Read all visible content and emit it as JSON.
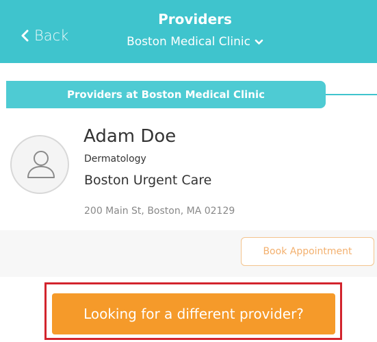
{
  "header": {
    "back_label": "Back",
    "title": "Providers",
    "clinic": "Boston Medical Clinic",
    "bg_color": "#3fc4cd"
  },
  "section": {
    "title": "Providers at Boston Medical Clinic"
  },
  "provider": {
    "name": "Adam Doe",
    "specialty": "Dermatology",
    "organization": "Boston Urgent Care",
    "address": "200 Main St, Boston, MA 02129",
    "avatar_icon": "user-icon",
    "book_label": "Book Appointment"
  },
  "cta": {
    "label": "Looking for a different provider?",
    "color": "#f59a2a",
    "highlight_color": "#d2242d"
  },
  "icons": {
    "back": "chevron-left-icon",
    "clinic_dropdown": "chevron-down-icon"
  }
}
